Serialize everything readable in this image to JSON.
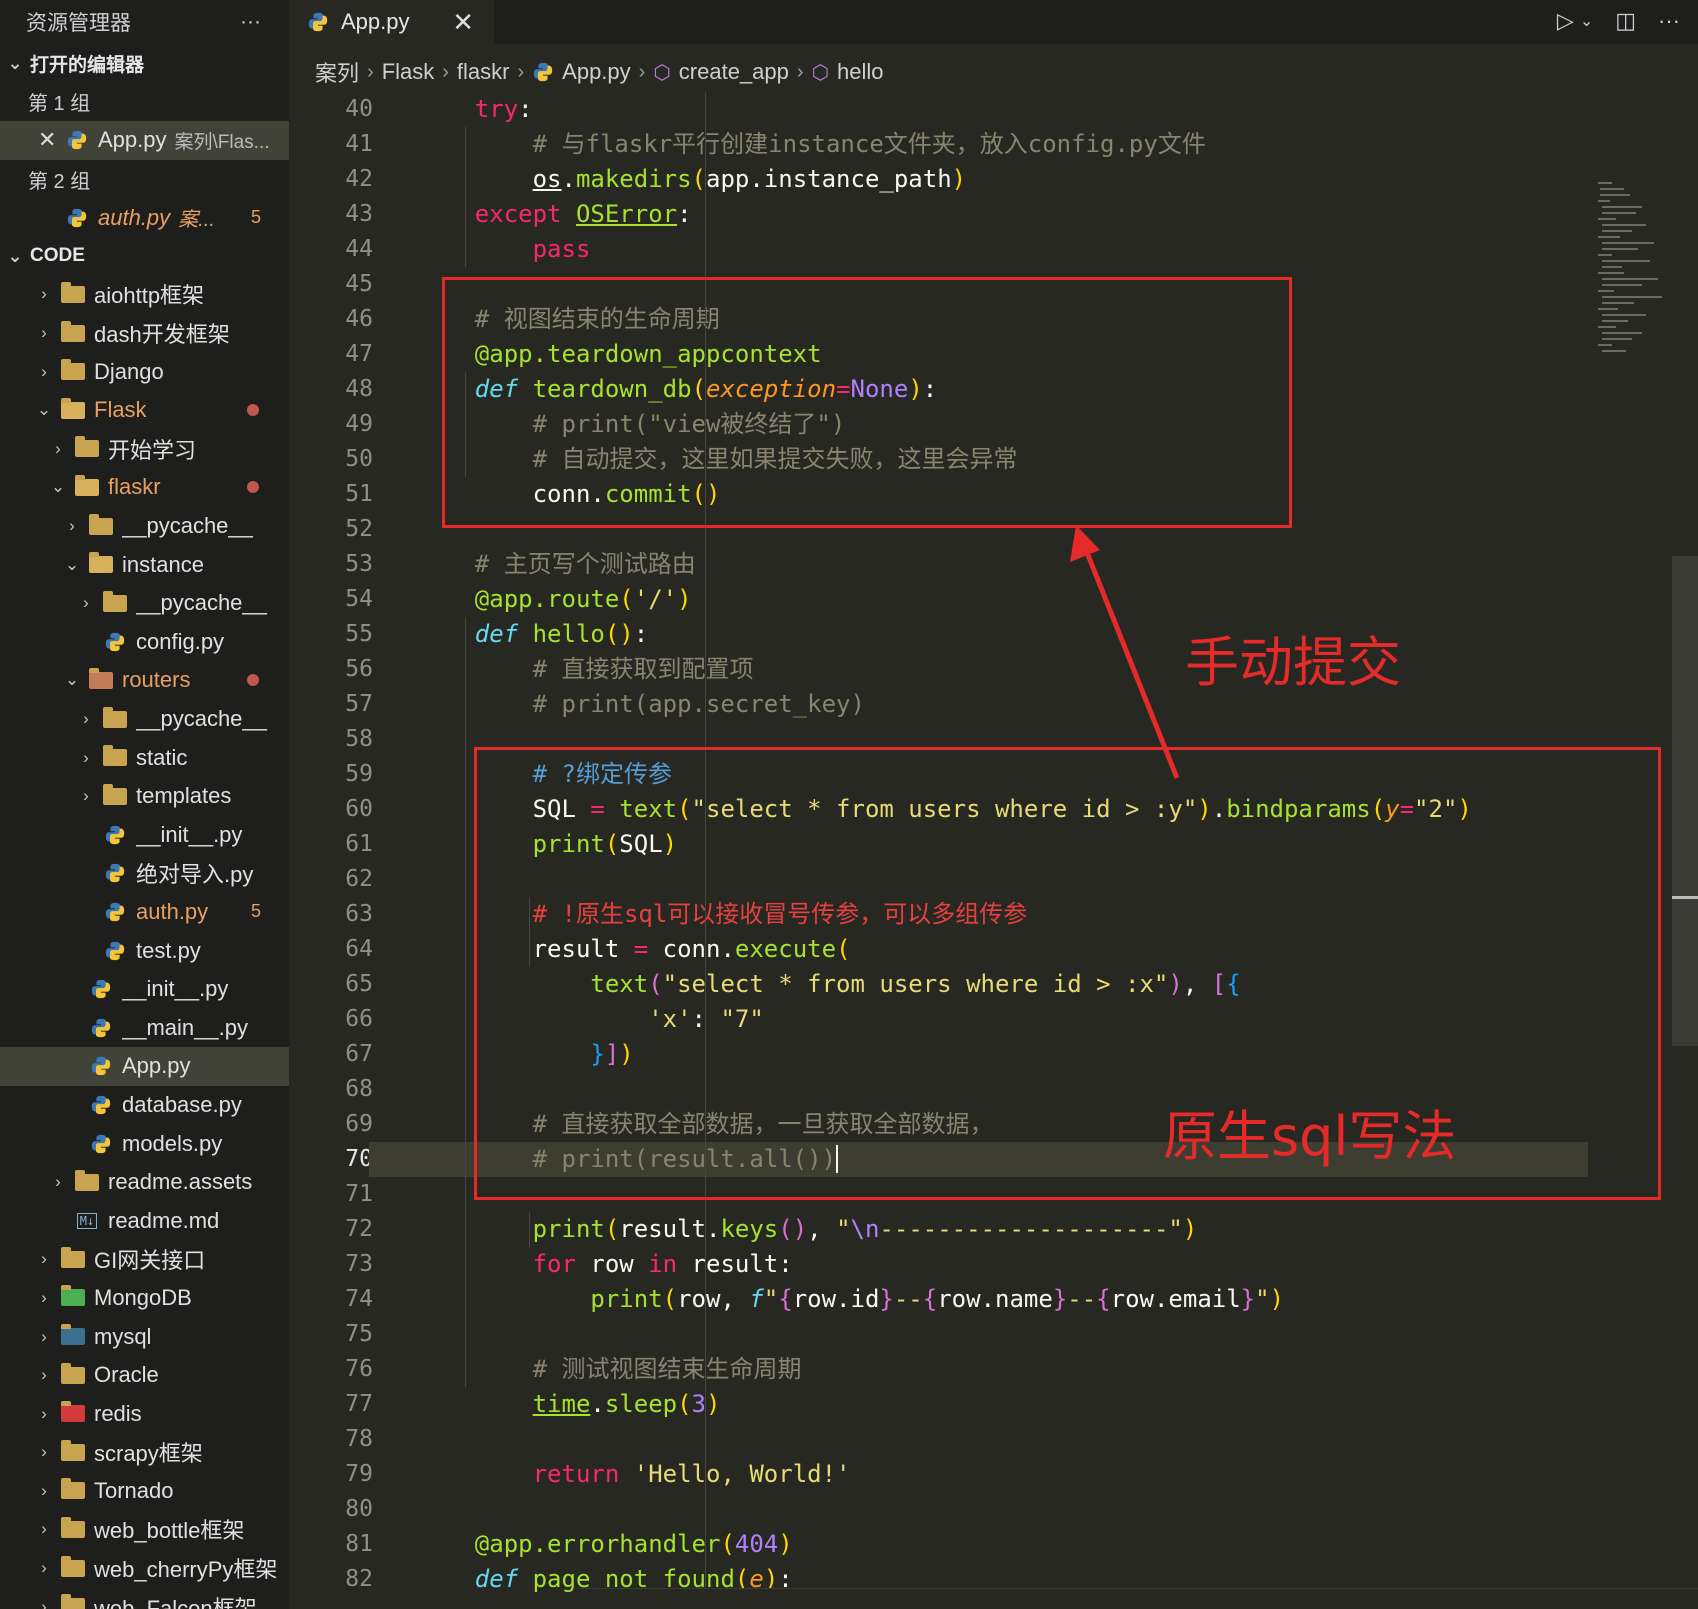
{
  "sidebar": {
    "title": "资源管理器",
    "more": "···",
    "open_editors": "打开的编辑器",
    "groups": [
      {
        "label": "第 1 组",
        "file": "App.py",
        "path": "案列\\Flas..."
      },
      {
        "label": "第 2 组",
        "file": "auth.py",
        "path": "案...",
        "badge": "5"
      }
    ],
    "workspace": "CODE",
    "tree": [
      {
        "label": "aiohttp框架",
        "depth": 0,
        "chev": "›",
        "icon": "folder"
      },
      {
        "label": "dash开发框架",
        "depth": 0,
        "chev": "›",
        "icon": "folder"
      },
      {
        "label": "Django",
        "depth": 0,
        "chev": "›",
        "icon": "folder"
      },
      {
        "label": "Flask",
        "depth": 0,
        "chev": "⌄",
        "icon": "folder-open",
        "modified": true
      },
      {
        "label": "开始学习",
        "depth": 1,
        "chev": "›",
        "icon": "folder"
      },
      {
        "label": "flaskr",
        "depth": 1,
        "chev": "⌄",
        "icon": "folder-open",
        "modified": true
      },
      {
        "label": "__pycache__",
        "depth": 2,
        "chev": "›",
        "icon": "folder"
      },
      {
        "label": "instance",
        "depth": 2,
        "chev": "⌄",
        "icon": "folder-open"
      },
      {
        "label": "__pycache__",
        "depth": 3,
        "chev": "›",
        "icon": "folder"
      },
      {
        "label": "config.py",
        "depth": 3,
        "chev": "",
        "icon": "python"
      },
      {
        "label": "routers",
        "depth": 2,
        "chev": "⌄",
        "icon": "folder-routers",
        "modified": true
      },
      {
        "label": "__pycache__",
        "depth": 3,
        "chev": "›",
        "icon": "folder"
      },
      {
        "label": "static",
        "depth": 3,
        "chev": "›",
        "icon": "folder"
      },
      {
        "label": "templates",
        "depth": 3,
        "chev": "›",
        "icon": "folder"
      },
      {
        "label": "__init__.py",
        "depth": 3,
        "chev": "",
        "icon": "python"
      },
      {
        "label": "绝对导入.py",
        "depth": 3,
        "chev": "",
        "icon": "python"
      },
      {
        "label": "auth.py",
        "depth": 3,
        "chev": "",
        "icon": "python",
        "error": true,
        "badge": "5"
      },
      {
        "label": "test.py",
        "depth": 3,
        "chev": "",
        "icon": "python"
      },
      {
        "label": "__init__.py",
        "depth": 2,
        "chev": "",
        "icon": "python"
      },
      {
        "label": "__main__.py",
        "depth": 2,
        "chev": "",
        "icon": "python"
      },
      {
        "label": "App.py",
        "depth": 2,
        "chev": "",
        "icon": "python",
        "selected": true
      },
      {
        "label": "database.py",
        "depth": 2,
        "chev": "",
        "icon": "python"
      },
      {
        "label": "models.py",
        "depth": 2,
        "chev": "",
        "icon": "python"
      },
      {
        "label": "readme.assets",
        "depth": 1,
        "chev": "›",
        "icon": "folder"
      },
      {
        "label": "readme.md",
        "depth": 1,
        "chev": "",
        "icon": "markdown"
      },
      {
        "label": "GI网关接口",
        "depth": 0,
        "chev": "›",
        "icon": "folder"
      },
      {
        "label": "MongoDB",
        "depth": 0,
        "chev": "›",
        "icon": "folder-green"
      },
      {
        "label": "mysql",
        "depth": 0,
        "chev": "›",
        "icon": "folder-mysql"
      },
      {
        "label": "Oracle",
        "depth": 0,
        "chev": "›",
        "icon": "folder"
      },
      {
        "label": "redis",
        "depth": 0,
        "chev": "›",
        "icon": "folder-redis"
      },
      {
        "label": "scrapy框架",
        "depth": 0,
        "chev": "›",
        "icon": "folder"
      },
      {
        "label": "Tornado",
        "depth": 0,
        "chev": "›",
        "icon": "folder"
      },
      {
        "label": "web_bottle框架",
        "depth": 0,
        "chev": "›",
        "icon": "folder"
      },
      {
        "label": "web_cherryPy框架",
        "depth": 0,
        "chev": "›",
        "icon": "folder"
      },
      {
        "label": "web_Falcon框架",
        "depth": 0,
        "chev": "›",
        "icon": "folder"
      }
    ]
  },
  "tab": {
    "label": "App.py",
    "close": "✕"
  },
  "breadcrumb": [
    "案列",
    "Flask",
    "flaskr",
    "App.py",
    "create_app",
    "hello"
  ],
  "editor": {
    "active_line": 70,
    "lines": [
      {
        "n": 40,
        "html": "    <span class='kw'>try</span>:"
      },
      {
        "n": 41,
        "html": "        <span class='cm'># 与flaskr平行创建instance文件夹，放入config.py文件</span>"
      },
      {
        "n": 42,
        "html": "        <span class='ul'>os</span>.<span class='fn'>makedirs</span><span class='b1'>(</span>app.instance_path<span class='b1'>)</span>"
      },
      {
        "n": 43,
        "html": "    <span class='kw'>except</span> <span class='fn ul'>OSError</span>:"
      },
      {
        "n": 44,
        "html": "        <span class='kw'>pass</span>"
      },
      {
        "n": 45,
        "html": ""
      },
      {
        "n": 46,
        "html": "    <span class='cm'># 视图结束的生命周期</span>"
      },
      {
        "n": 47,
        "html": "    <span class='fn'>@app.teardown_appcontext</span>"
      },
      {
        "n": 48,
        "html": "    <span class='it'>def</span> <span class='fn'>teardown_db</span><span class='b1'>(</span><span class='par'>exception</span><span class='kw'>=</span><span class='num'>None</span><span class='b1'>)</span>:"
      },
      {
        "n": 49,
        "html": "        <span class='cm'># print(\"view被终结了\")</span>"
      },
      {
        "n": 50,
        "html": "        <span class='cm'># 自动提交，这里如果提交失败，这里会异常</span>"
      },
      {
        "n": 51,
        "html": "        conn.<span class='fn'>commit</span><span class='b1'>()</span>"
      },
      {
        "n": 52,
        "html": ""
      },
      {
        "n": 53,
        "html": "    <span class='cm'># 主页写个测试路由</span>"
      },
      {
        "n": 54,
        "html": "    <span class='fn'>@app.route</span><span class='b1'>(</span><span class='st'>'/'</span><span class='b1'>)</span>"
      },
      {
        "n": 55,
        "html": "    <span class='it'>def</span> <span class='fn'>hello</span><span class='b1'>()</span>:"
      },
      {
        "n": 56,
        "html": "        <span class='cm'># 直接获取到配置项</span>"
      },
      {
        "n": 57,
        "html": "        <span class='cm'># print(app.secret_key)</span>"
      },
      {
        "n": 58,
        "html": ""
      },
      {
        "n": 59,
        "html": "        <span class='hl-blue'># ?绑定传参</span>"
      },
      {
        "n": 60,
        "html": "        SQL <span class='kw'>=</span> <span class='fn'>text</span><span class='b1'>(</span><span class='st'>\"select * from users where id > :y\"</span><span class='b1'>)</span>.<span class='fn'>bindparams</span><span class='b1'>(</span><span class='par'>y</span><span class='kw'>=</span><span class='st'>\"2\"</span><span class='b1'>)</span>"
      },
      {
        "n": 61,
        "html": "        <span class='fn'>print</span><span class='b1'>(</span>SQL<span class='b1'>)</span>"
      },
      {
        "n": 62,
        "html": ""
      },
      {
        "n": 63,
        "html": "        <span class='todo-red'># !原生sql可以接收冒号传参，可以多组传参</span>"
      },
      {
        "n": 64,
        "html": "        result <span class='kw'>=</span> conn.<span class='fn'>execute</span><span class='b1'>(</span>"
      },
      {
        "n": 65,
        "html": "            <span class='fn'>text</span><span class='b2'>(</span><span class='st'>\"select * from users where id > :x\"</span><span class='b2'>)</span>, <span class='b2'>[</span><span class='b3'>{</span>"
      },
      {
        "n": 66,
        "html": "                <span class='st'>'x'</span>: <span class='st'>\"7\"</span>"
      },
      {
        "n": 67,
        "html": "            <span class='b3'>}</span><span class='b2'>]</span><span class='b1'>)</span>"
      },
      {
        "n": 68,
        "html": ""
      },
      {
        "n": 69,
        "html": "        <span class='cm'># 直接获取全部数据，一旦获取全部数据，</span>"
      },
      {
        "n": 70,
        "html": "        <span class='cm'># print(result.all())</span><span style='border-left:2px solid #f8f8f0'></span>"
      },
      {
        "n": 71,
        "html": ""
      },
      {
        "n": 72,
        "html": "        <span class='fn'>print</span><span class='b1'>(</span>result.<span class='fn'>keys</span><span class='b2'>()</span>, <span class='st'>\"</span><span class='num'>\\n</span><span class='st'>--------------------\"</span><span class='b1'>)</span>"
      },
      {
        "n": 73,
        "html": "        <span class='kw'>for</span> row <span class='kw'>in</span> result:"
      },
      {
        "n": 74,
        "html": "            <span class='fn'>print</span><span class='b1'>(</span>row, <span class='it'>f</span><span class='st'>\"</span><span class='b2'>{</span>row.id<span class='b2'>}</span><span class='st'>--</span><span class='b2'>{</span>row.name<span class='b2'>}</span><span class='st'>--</span><span class='b2'>{</span>row.email<span class='b2'>}</span><span class='st'>\"</span><span class='b1'>)</span>"
      },
      {
        "n": 75,
        "html": ""
      },
      {
        "n": 76,
        "html": "        <span class='cm'># 测试视图结束生命周期</span>"
      },
      {
        "n": 77,
        "html": "        <span class='ul fn'>time</span>.<span class='fn'>sleep</span><span class='b1'>(</span><span class='num'>3</span><span class='b1'>)</span>"
      },
      {
        "n": 78,
        "html": ""
      },
      {
        "n": 79,
        "html": "        <span class='kw'>return</span> <span class='st'>'Hello, World!'</span>"
      },
      {
        "n": 80,
        "html": ""
      },
      {
        "n": 81,
        "html": "    <span class='fn'>@app.errorhandler</span><span class='b1'>(</span><span class='num'>404</span><span class='b1'>)</span>"
      },
      {
        "n": 82,
        "html": "    <span class='it'>def</span> <span class='fn'>page_not_found</span><span class='b1'>(</span><span class='par'>e</span><span class='b1'>)</span>:"
      }
    ]
  },
  "annotations": {
    "manual_commit": "手动提交",
    "raw_sql": "原生sql写法",
    "color": "#e52a2a"
  },
  "colors": {
    "editor_bg": "#272822",
    "sidebar_bg": "#1e1f1c",
    "selected_bg": "#414339",
    "keyword": "#f92672",
    "function": "#a6e22e",
    "comment": "#88846f",
    "string": "#e6db74"
  }
}
